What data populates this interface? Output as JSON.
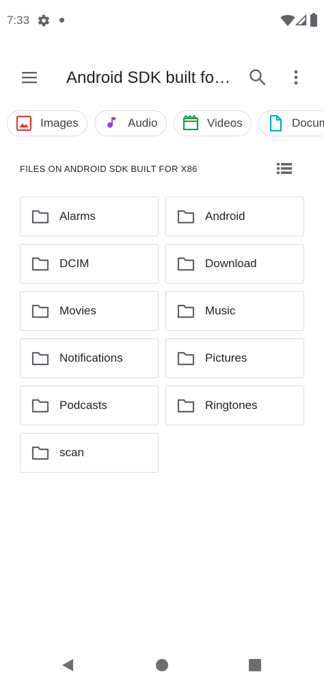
{
  "status_bar": {
    "time": "7:33",
    "icons": [
      "gear-icon",
      "notification-dot",
      "wifi-icon",
      "signal-icon",
      "battery-icon"
    ]
  },
  "toolbar": {
    "title": "Android SDK built fo…",
    "icons": [
      "menu-icon",
      "search-icon",
      "more-vert-icon"
    ]
  },
  "chips": [
    {
      "label": "Images",
      "icon": "image-icon",
      "color": "#e53935"
    },
    {
      "label": "Audio",
      "icon": "music-note-icon",
      "color": "#8e44e0"
    },
    {
      "label": "Videos",
      "icon": "movie-icon",
      "color": "#1e9e3e"
    },
    {
      "label": "Docum",
      "icon": "document-icon",
      "color": "#03a9d4"
    }
  ],
  "section": {
    "title": "FILES ON ANDROID SDK BUILT FOR X86",
    "view_toggle_icon": "list-view-icon"
  },
  "folders": [
    {
      "name": "Alarms"
    },
    {
      "name": "Android"
    },
    {
      "name": "DCIM"
    },
    {
      "name": "Download"
    },
    {
      "name": "Movies"
    },
    {
      "name": "Music"
    },
    {
      "name": "Notifications"
    },
    {
      "name": "Pictures"
    },
    {
      "name": "Podcasts"
    },
    {
      "name": "Ringtones"
    },
    {
      "name": "scan"
    }
  ],
  "nav_bar": {
    "icons": [
      "back-icon",
      "home-icon",
      "recents-icon"
    ]
  }
}
